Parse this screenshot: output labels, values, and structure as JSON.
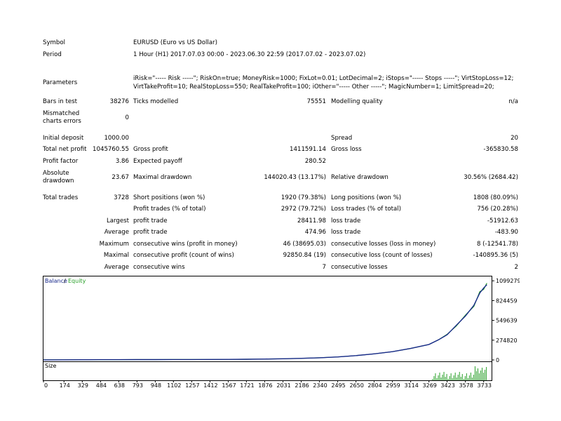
{
  "report": {
    "symbol_label": "Symbol",
    "symbol_value": "EURUSD (Euro vs US Dollar)",
    "period_label": "Period",
    "period_value": "1 Hour (H1) 2017.07.03 00:00 - 2023.06.30 22:59 (2017.07.02 - 2023.07.02)",
    "parameters_label": "Parameters",
    "parameters_line1": "iRisk=\"----- Risk -----\"; RiskOn=true; MoneyRisk=1000; FixLot=0.01; LotDecimal=2; iStops=\"----- Stops -----\"; VirtStopLoss=12;",
    "parameters_line2": "VirtTakeProfit=10; RealStopLoss=550; RealTakeProfit=100; iOther=\"----- Other -----\"; MagicNumber=1; LimitSpread=20;",
    "bars_label": "Bars in test",
    "bars_value": "38276",
    "ticks_label": "Ticks modelled",
    "ticks_value": "75551",
    "quality_label": "Modelling quality",
    "quality_value": "n/a",
    "mismatch_label_1": "Mismatched",
    "mismatch_label_2": "charts errors",
    "mismatch_value": "0",
    "deposit_label": "Initial deposit",
    "deposit_value": "1000.00",
    "spread_label": "Spread",
    "spread_value": "20",
    "netprofit_label": "Total net profit",
    "netprofit_value": "1045760.55",
    "grossprofit_label": "Gross profit",
    "grossprofit_value": "1411591.14",
    "grossloss_label": "Gross loss",
    "grossloss_value": "-365830.58",
    "pf_label": "Profit factor",
    "pf_value": "3.86",
    "ep_label": "Expected payoff",
    "ep_value": "280.52",
    "absdd_label_1": "Absolute",
    "absdd_label_2": "drawdown",
    "absdd_value": "23.67",
    "maxdd_label": "Maximal drawdown",
    "maxdd_value": "144020.43 (13.17%)",
    "reldd_label": "Relative drawdown",
    "reldd_value": "30.56% (2684.42)",
    "trades_label": "Total trades",
    "trades_value": "3728",
    "short_label": "Short positions (won %)",
    "short_value": "1920 (79.38%)",
    "long_label": "Long positions (won %)",
    "long_value": "1808 (80.09%)",
    "pt_label": "Profit trades (% of total)",
    "pt_value": "2972 (79.72%)",
    "lt_label": "Loss trades (% of total)",
    "lt_value": "756 (20.28%)",
    "largest_label": "Largest",
    "largest_profit_label": "profit trade",
    "largest_profit_value": "28411.98",
    "largest_loss_label": "loss trade",
    "largest_loss_value": "-51912.63",
    "average_label": "Average",
    "average_profit_label": "profit trade",
    "average_profit_value": "474.96",
    "average_loss_label": "loss trade",
    "average_loss_value": "-483.90",
    "maximum_label": "Maximum",
    "max_cw_label": "consecutive wins (profit in money)",
    "max_cw_value": "46 (38695.03)",
    "max_cl_label": "consecutive losses (loss in money)",
    "max_cl_value": "8 (-12541.78)",
    "maximal_label": "Maximal",
    "maximal_cp_label": "consecutive profit (count of wins)",
    "maximal_cp_value": "92850.84 (19)",
    "maximal_cl_label": "consecutive loss (count of losses)",
    "maximal_cl_value": "-140895.36 (5)",
    "average2_label": "Average",
    "avg_cw_label": "consecutive wins",
    "avg_cw_value": "7",
    "avg_cl_label": "consecutive losses",
    "avg_cl_value": "2"
  },
  "chart_data": {
    "type": "line",
    "legend": {
      "balance": "Balance",
      "separator": " / ",
      "equity": "Equity"
    },
    "size_label": "Size",
    "colors": {
      "balance": "#1a2a8c",
      "equity": "#2aa02a",
      "size": "#2aa02a"
    },
    "xlim": [
      0,
      3800
    ],
    "ylim": [
      0,
      1150000
    ],
    "y_ticks": [
      0,
      274820,
      549639,
      824459,
      1099279
    ],
    "y_tick_labels": [
      "0",
      "274820",
      "549639",
      "824459",
      "1099279"
    ],
    "x_ticks": [
      0,
      174,
      329,
      484,
      638,
      793,
      948,
      1102,
      1257,
      1412,
      1567,
      1721,
      1876,
      2031,
      2186,
      2340,
      2495,
      2650,
      2804,
      2959,
      3114,
      3269,
      3423,
      3578,
      3733
    ],
    "x_tick_labels": [
      "0",
      "174",
      "329",
      "484",
      "638",
      "793",
      "948",
      "1102",
      "1257",
      "1412",
      "1567",
      "1721",
      "1876",
      "2031",
      "2186",
      "2340",
      "2495",
      "2650",
      "2804",
      "2959",
      "3114",
      "3269",
      "3423",
      "3578",
      "3733"
    ],
    "series": [
      {
        "name": "Balance",
        "x": [
          0,
          174,
          329,
          484,
          638,
          793,
          948,
          1102,
          1257,
          1412,
          1567,
          1721,
          1876,
          2031,
          2186,
          2340,
          2495,
          2650,
          2804,
          2959,
          3114,
          3269,
          3350,
          3423,
          3500,
          3578,
          3650,
          3700,
          3733,
          3760
        ],
        "values": [
          1000,
          1500,
          2500,
          3500,
          4000,
          4500,
          5000,
          5500,
          6000,
          7000,
          8000,
          10000,
          13000,
          17000,
          22000,
          30000,
          42000,
          60000,
          85000,
          115000,
          160000,
          215000,
          280000,
          350000,
          480000,
          610000,
          760000,
          930000,
          1000000,
          1045760
        ]
      }
    ]
  }
}
